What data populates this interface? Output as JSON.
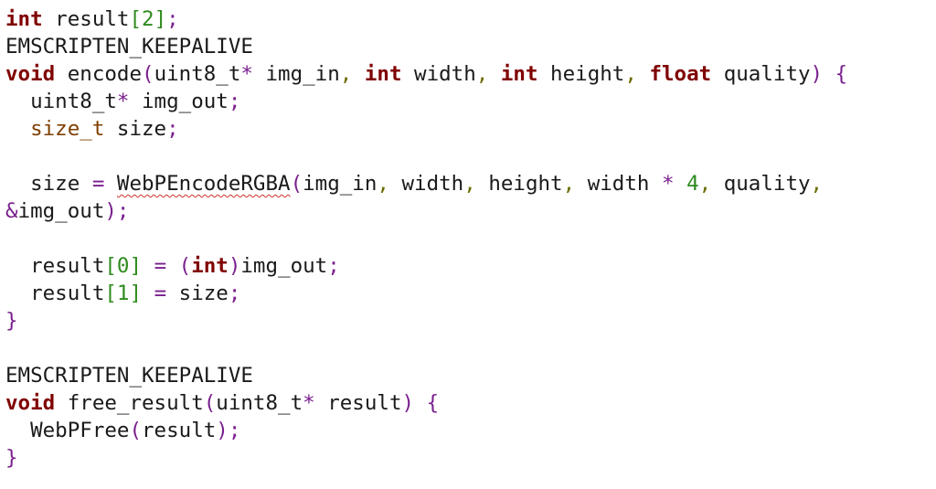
{
  "editor": {
    "lines": [
      [
        {
          "t": "int",
          "c": "kw"
        },
        {
          "t": " result",
          "c": "plain"
        },
        {
          "t": "[",
          "c": "bracket"
        },
        {
          "t": "2",
          "c": "num"
        },
        {
          "t": "]",
          "c": "bracket"
        },
        {
          "t": ";",
          "c": "punct"
        }
      ],
      [
        {
          "t": "EMSCRIPTEN_KEEPALIVE",
          "c": "plain"
        }
      ],
      [
        {
          "t": "void",
          "c": "kw"
        },
        {
          "t": " encode",
          "c": "plain"
        },
        {
          "t": "(",
          "c": "paren"
        },
        {
          "t": "uint8_t",
          "c": "plain"
        },
        {
          "t": "*",
          "c": "op"
        },
        {
          "t": " img_in",
          "c": "plain"
        },
        {
          "t": ",",
          "c": "comma"
        },
        {
          "t": " ",
          "c": "plain"
        },
        {
          "t": "int",
          "c": "kw"
        },
        {
          "t": " width",
          "c": "plain"
        },
        {
          "t": ",",
          "c": "comma"
        },
        {
          "t": " ",
          "c": "plain"
        },
        {
          "t": "int",
          "c": "kw"
        },
        {
          "t": " height",
          "c": "plain"
        },
        {
          "t": ",",
          "c": "comma"
        },
        {
          "t": " ",
          "c": "plain"
        },
        {
          "t": "float",
          "c": "kw"
        },
        {
          "t": " quality",
          "c": "plain"
        },
        {
          "t": ")",
          "c": "paren"
        },
        {
          "t": " ",
          "c": "plain"
        },
        {
          "t": "{",
          "c": "brace"
        }
      ],
      [
        {
          "t": "  uint8_t",
          "c": "plain"
        },
        {
          "t": "*",
          "c": "op"
        },
        {
          "t": " img_out",
          "c": "plain"
        },
        {
          "t": ";",
          "c": "punct"
        }
      ],
      [
        {
          "t": "  ",
          "c": "plain"
        },
        {
          "t": "size_t",
          "c": "type"
        },
        {
          "t": " size",
          "c": "plain"
        },
        {
          "t": ";",
          "c": "punct"
        }
      ],
      [],
      [
        {
          "t": "  size ",
          "c": "plain"
        },
        {
          "t": "=",
          "c": "op"
        },
        {
          "t": " ",
          "c": "plain"
        },
        {
          "t": "WebPEncodeRGBA",
          "c": "squiggle"
        },
        {
          "t": "(",
          "c": "paren"
        },
        {
          "t": "img_in",
          "c": "plain"
        },
        {
          "t": ",",
          "c": "comma"
        },
        {
          "t": " width",
          "c": "plain"
        },
        {
          "t": ",",
          "c": "comma"
        },
        {
          "t": " height",
          "c": "plain"
        },
        {
          "t": ",",
          "c": "comma"
        },
        {
          "t": " width ",
          "c": "plain"
        },
        {
          "t": "*",
          "c": "op"
        },
        {
          "t": " ",
          "c": "plain"
        },
        {
          "t": "4",
          "c": "num"
        },
        {
          "t": ",",
          "c": "comma"
        },
        {
          "t": " quality",
          "c": "plain"
        },
        {
          "t": ",",
          "c": "comma"
        }
      ],
      [
        {
          "t": "&",
          "c": "op"
        },
        {
          "t": "img_out",
          "c": "plain"
        },
        {
          "t": ")",
          "c": "paren"
        },
        {
          "t": ";",
          "c": "punct"
        }
      ],
      [],
      [
        {
          "t": "  result",
          "c": "plain"
        },
        {
          "t": "[",
          "c": "bracket"
        },
        {
          "t": "0",
          "c": "num"
        },
        {
          "t": "]",
          "c": "bracket"
        },
        {
          "t": " ",
          "c": "plain"
        },
        {
          "t": "=",
          "c": "op"
        },
        {
          "t": " ",
          "c": "plain"
        },
        {
          "t": "(",
          "c": "paren"
        },
        {
          "t": "int",
          "c": "kw"
        },
        {
          "t": ")",
          "c": "paren"
        },
        {
          "t": "img_out",
          "c": "plain"
        },
        {
          "t": ";",
          "c": "punct"
        }
      ],
      [
        {
          "t": "  result",
          "c": "plain"
        },
        {
          "t": "[",
          "c": "bracket"
        },
        {
          "t": "1",
          "c": "num"
        },
        {
          "t": "]",
          "c": "bracket"
        },
        {
          "t": " ",
          "c": "plain"
        },
        {
          "t": "=",
          "c": "op"
        },
        {
          "t": " size",
          "c": "plain"
        },
        {
          "t": ";",
          "c": "punct"
        }
      ],
      [
        {
          "t": "}",
          "c": "brace"
        }
      ],
      [],
      [
        {
          "t": "EMSCRIPTEN_KEEPALIVE",
          "c": "plain"
        }
      ],
      [
        {
          "t": "void",
          "c": "kw"
        },
        {
          "t": " free_result",
          "c": "plain"
        },
        {
          "t": "(",
          "c": "paren"
        },
        {
          "t": "uint8_t",
          "c": "plain"
        },
        {
          "t": "*",
          "c": "op"
        },
        {
          "t": " result",
          "c": "plain"
        },
        {
          "t": ")",
          "c": "paren"
        },
        {
          "t": " ",
          "c": "plain"
        },
        {
          "t": "{",
          "c": "brace"
        }
      ],
      [
        {
          "t": "  WebPFree",
          "c": "plain"
        },
        {
          "t": "(",
          "c": "paren"
        },
        {
          "t": "result",
          "c": "plain"
        },
        {
          "t": ")",
          "c": "paren"
        },
        {
          "t": ";",
          "c": "punct"
        }
      ],
      [
        {
          "t": "}",
          "c": "brace"
        }
      ]
    ]
  },
  "colors": {
    "background": "#ffffff",
    "keyword": "#800000",
    "type": "#7f3f00",
    "number": "#2e8b1e",
    "operator": "#7a1f8e",
    "comma": "#6b6b00",
    "text": "#1a1a1a",
    "spellcheck_underline": "#d0312d"
  }
}
